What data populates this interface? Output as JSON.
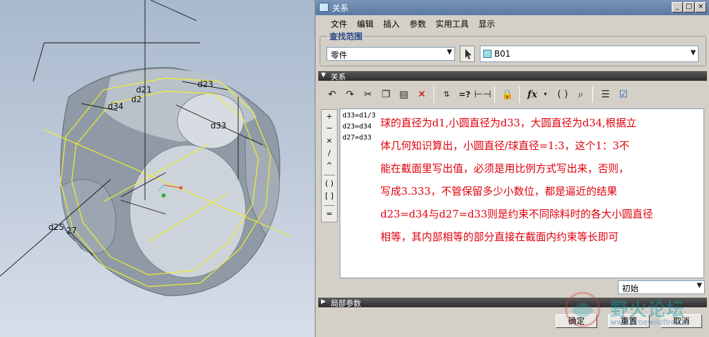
{
  "viewport": {
    "dim_labels": [
      "d21",
      "d2",
      "d34",
      "d23",
      "d33",
      "d25",
      "27"
    ]
  },
  "window": {
    "title": "关系",
    "controls": [
      "_",
      "□",
      "×"
    ]
  },
  "menu": [
    "文件",
    "编辑",
    "插入",
    "参数",
    "实用工具",
    "显示"
  ],
  "search": {
    "legend": "查找范围",
    "type_value": "零件",
    "part_value": "B01"
  },
  "relations_section": {
    "label": "关系"
  },
  "toolbar_icons": [
    "undo-icon",
    "redo-icon",
    "cut-icon",
    "copy-icon",
    "paste-icon",
    "delete-icon",
    "show-values-icon",
    "evaluate-icon",
    "units-icon",
    "lock-icon",
    "function-icon",
    "brackets-icon",
    "search-icon",
    "sort-icon",
    "verify-icon"
  ],
  "toolbar_text": {
    "evaluate": "=?",
    "function": "fx",
    "brackets": "( )"
  },
  "side_buttons": [
    "+",
    "−",
    "×",
    "/",
    "^",
    "( )",
    "[ ]",
    "="
  ],
  "relations": [
    "d33=d1/3",
    "d23=d34",
    "d27=d33"
  ],
  "note_lines": [
    "球的直径为d1,小圆直径为d33，大圆直径为d34,根据立",
    "体几何知识算出，小圆直径/球直径=1:3，这个1：3不",
    "能在截面里写出值，必须是用比例方式写出来，否则，",
    "写成3.333，不管保留多少小数位，都是逼近的结果",
    "d23=d34与d27=d33则是约束不同除料时的各大小圆直径",
    "相等，其内部相等的部分直接在截面内约束等长即可"
  ],
  "state": {
    "value": "初始"
  },
  "local_params": {
    "label": "局部参数"
  },
  "buttons": {
    "ok": "确定",
    "reset": "重置",
    "cancel": "取消"
  },
  "watermark": {
    "text": "野火论坛",
    "url": "www.proewildfire.cn"
  }
}
